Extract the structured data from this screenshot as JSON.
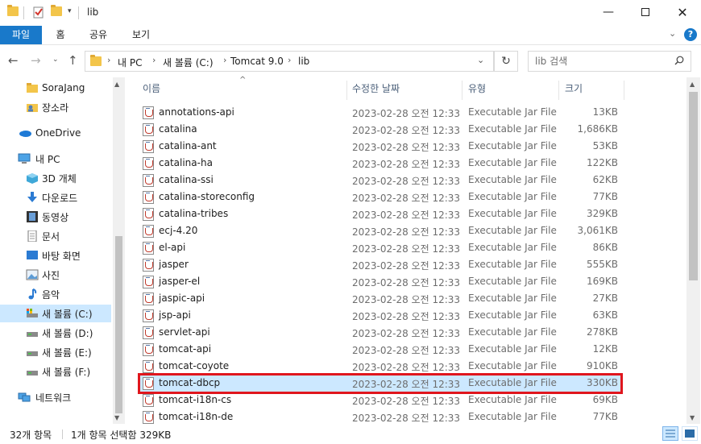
{
  "window": {
    "title": "lib",
    "min_icon": "minimize-icon",
    "max_icon": "maximize-icon",
    "close_icon": "close-icon"
  },
  "ribbon": {
    "tabs": [
      {
        "label": "파일"
      },
      {
        "label": "홈"
      },
      {
        "label": "공유"
      },
      {
        "label": "보기"
      }
    ],
    "accent": "#1979ca"
  },
  "address": {
    "crumbs": [
      "내 PC",
      "새 볼륨 (C:)",
      "Tomcat 9.0",
      "lib"
    ]
  },
  "search": {
    "placeholder": "lib 검색"
  },
  "nav": {
    "items": [
      {
        "label": "SoraJang"
      },
      {
        "label": "장소라"
      },
      {
        "label": "OneDrive"
      },
      {
        "label": "내 PC"
      },
      {
        "label": "3D 개체"
      },
      {
        "label": "다운로드"
      },
      {
        "label": "동영상"
      },
      {
        "label": "문서"
      },
      {
        "label": "바탕 화면"
      },
      {
        "label": "사진"
      },
      {
        "label": "음악"
      },
      {
        "label": "새 볼륨 (C:)"
      },
      {
        "label": "새 볼륨 (D:)"
      },
      {
        "label": "새 볼륨 (E:)"
      },
      {
        "label": "새 볼륨 (F:)"
      },
      {
        "label": "네트워크"
      }
    ]
  },
  "columns": {
    "name": "이름",
    "date": "수정한 날짜",
    "type": "유형",
    "size": "크기"
  },
  "files": [
    {
      "name": "annotations-api",
      "date": "2023-02-28 오전 12:33",
      "type": "Executable Jar File",
      "size": "13KB"
    },
    {
      "name": "catalina",
      "date": "2023-02-28 오전 12:33",
      "type": "Executable Jar File",
      "size": "1,686KB"
    },
    {
      "name": "catalina-ant",
      "date": "2023-02-28 오전 12:33",
      "type": "Executable Jar File",
      "size": "53KB"
    },
    {
      "name": "catalina-ha",
      "date": "2023-02-28 오전 12:33",
      "type": "Executable Jar File",
      "size": "122KB"
    },
    {
      "name": "catalina-ssi",
      "date": "2023-02-28 오전 12:33",
      "type": "Executable Jar File",
      "size": "62KB"
    },
    {
      "name": "catalina-storeconfig",
      "date": "2023-02-28 오전 12:33",
      "type": "Executable Jar File",
      "size": "77KB"
    },
    {
      "name": "catalina-tribes",
      "date": "2023-02-28 오전 12:33",
      "type": "Executable Jar File",
      "size": "329KB"
    },
    {
      "name": "ecj-4.20",
      "date": "2023-02-28 오전 12:33",
      "type": "Executable Jar File",
      "size": "3,061KB"
    },
    {
      "name": "el-api",
      "date": "2023-02-28 오전 12:33",
      "type": "Executable Jar File",
      "size": "86KB"
    },
    {
      "name": "jasper",
      "date": "2023-02-28 오전 12:33",
      "type": "Executable Jar File",
      "size": "555KB"
    },
    {
      "name": "jasper-el",
      "date": "2023-02-28 오전 12:33",
      "type": "Executable Jar File",
      "size": "169KB"
    },
    {
      "name": "jaspic-api",
      "date": "2023-02-28 오전 12:33",
      "type": "Executable Jar File",
      "size": "27KB"
    },
    {
      "name": "jsp-api",
      "date": "2023-02-28 오전 12:33",
      "type": "Executable Jar File",
      "size": "63KB"
    },
    {
      "name": "servlet-api",
      "date": "2023-02-28 오전 12:33",
      "type": "Executable Jar File",
      "size": "278KB"
    },
    {
      "name": "tomcat-api",
      "date": "2023-02-28 오전 12:33",
      "type": "Executable Jar File",
      "size": "12KB"
    },
    {
      "name": "tomcat-coyote",
      "date": "2023-02-28 오전 12:33",
      "type": "Executable Jar File",
      "size": "910KB"
    },
    {
      "name": "tomcat-dbcp",
      "date": "2023-02-28 오전 12:33",
      "type": "Executable Jar File",
      "size": "330KB"
    },
    {
      "name": "tomcat-i18n-cs",
      "date": "2023-02-28 오전 12:33",
      "type": "Executable Jar File",
      "size": "69KB"
    },
    {
      "name": "tomcat-i18n-de",
      "date": "2023-02-28 오전 12:33",
      "type": "Executable Jar File",
      "size": "77KB"
    }
  ],
  "selected_file": "tomcat-dbcp",
  "highlight_color": "#e0161d",
  "status": {
    "count": "32개 항목",
    "selection": "1개 항목 선택함 329KB"
  }
}
